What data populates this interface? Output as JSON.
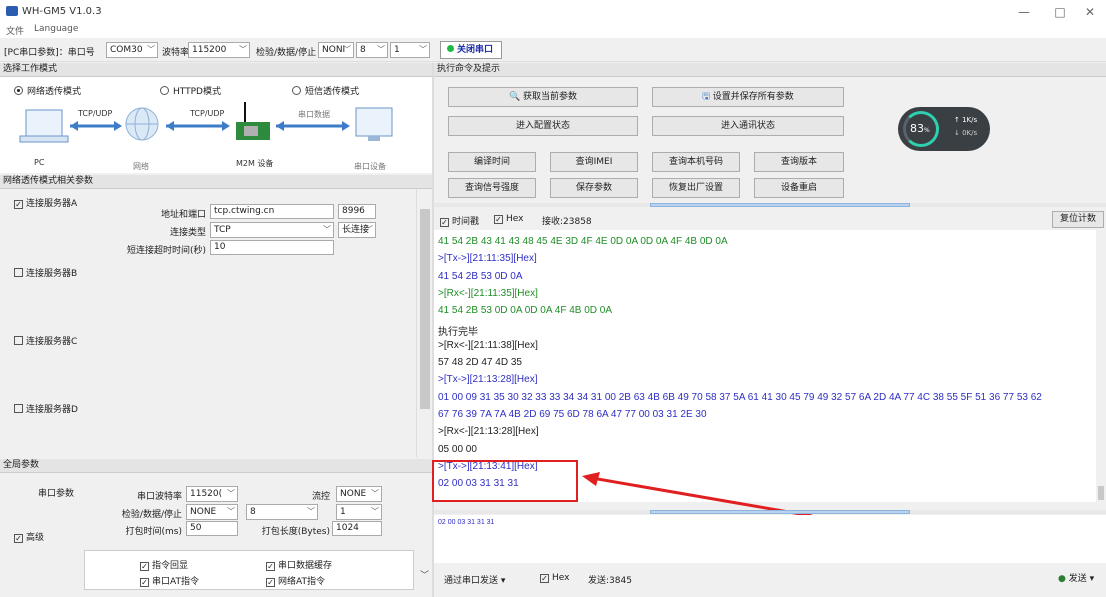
{
  "window": {
    "title": "WH-GM5 V1.0.3",
    "minimize": "—",
    "maximize": "□",
    "close": "✕"
  },
  "menu": [
    "文件",
    "Language"
  ],
  "toolbar": {
    "port_label": "[PC串口参数]：串口号",
    "port": "COM30",
    "baud_label": "波特率",
    "baud": "115200",
    "check_label": "检验/数据/停止",
    "parity": "NONI",
    "data_bits": "8",
    "stop_bits": "1",
    "open_button": "关闭串口"
  },
  "work_mode": {
    "header": "选择工作模式",
    "modes": [
      "网络透传模式",
      "HTTPD模式",
      "短信透传模式"
    ],
    "selected": 0
  },
  "diagram": {
    "tcp1": "TCP/UDP",
    "tcp2": "TCP/UDP",
    "serial_data": "串口数据",
    "pc": "PC",
    "network": "网络",
    "m2m": "M2M 设备",
    "serial_device": "串口设备"
  },
  "net_params": {
    "header": "网络透传模式相关参数",
    "server_a": "连接服务器A",
    "addr_label": "地址和端口",
    "addr": "tcp.ctwing.cn",
    "port": "8996",
    "conn_type_label": "连接类型",
    "conn_type": "TCP",
    "conn_mode": "长连接",
    "timeout_label": "短连接超时时间(秒)",
    "timeout": "10",
    "server_b": "连接服务器B",
    "server_c": "连接服务器C",
    "server_d": "连接服务器D"
  },
  "global": {
    "header": "全局参数",
    "serial_params": "串口参数",
    "baud_label": "串口波特率",
    "baud": "11520(",
    "flow_label": "流控",
    "flow": "NONE",
    "check_label": "检验/数据/停止",
    "parity": "NONE",
    "data_bits": "8",
    "stop_bits": "1",
    "pack_time_label": "打包时间(ms)",
    "pack_time": "50",
    "pack_len_label": "打包长度(Bytes)",
    "pack_len": "1024",
    "advanced": "高级",
    "opt1": "指令回显",
    "opt2": "串口数据缓存",
    "opt3": "串口AT指令",
    "opt4": "网络AT指令"
  },
  "commands": {
    "header": "执行命令及提示",
    "get_params": "获取当前参数",
    "save_all": "设置并保存所有参数",
    "enter_config": "进入配置状态",
    "enter_comm": "进入通讯状态",
    "compile_time": "编译时间",
    "query_imei": "查询IMEI",
    "query_number": "查询本机号码",
    "query_version": "查询版本",
    "query_signal": "查询信号强度",
    "save_params": "保存参数",
    "factory_reset": "恢复出厂设置",
    "reboot": "设备重启"
  },
  "gauge": {
    "percent": "83",
    "unit": "%",
    "up": "1K/s",
    "down": "0K/s"
  },
  "receive": {
    "time_label": "时间戳",
    "hex_label": "Hex",
    "count_label": "接收:23858",
    "reset": "复位计数"
  },
  "log": [
    {
      "t": "41 54 2B 43 41 43 48 45 4E 3D 4F 4E 0D 0A 0D 0A 4F 4B 0D 0A",
      "c": "green"
    },
    {
      "t": ">[Tx->][21:11:35][Hex]",
      "c": "blue"
    },
    {
      "t": "41 54 2B 53 0D 0A",
      "c": "blue"
    },
    {
      "t": ">[Rx<-][21:11:35][Hex]",
      "c": "green"
    },
    {
      "t": "41 54 2B 53 0D 0A 0D 0A 4F 4B 0D 0A",
      "c": "green"
    },
    {
      "t": "执行完毕",
      "c": "black"
    },
    {
      "t": ">[Rx<-][21:11:38][Hex]",
      "c": "black"
    },
    {
      "t": "57 48 2D 47 4D 35",
      "c": "black"
    },
    {
      "t": ">[Tx->][21:13:28][Hex]",
      "c": "blue"
    },
    {
      "t": "01 00 09 31 35 30 32 33 33 34 34 31 00 2B 63 4B 6B 49 70 58 37 5A 61 41 30 45 79 49 32 57 6A 2D 4A 77 4C 38 55 5F 51 36 77 53 62",
      "c": "blue"
    },
    {
      "t": "67 76 39 7A 7A 4B 2D 69 75 6D 78 6A 47 77 00 03 31 2E 30",
      "c": "blue"
    },
    {
      "t": ">[Rx<-][21:13:28][Hex]",
      "c": "black"
    },
    {
      "t": "05 00 00",
      "c": "black"
    },
    {
      "t": ">[Tx->][21:13:41][Hex]",
      "c": "blue"
    },
    {
      "t": "02 00 03 31 31 31",
      "c": "blue"
    }
  ],
  "send": {
    "text": "02 00 03 31 31 31",
    "via": "通过串口发送 ▾",
    "hex_label": "Hex",
    "count": "发送:3845",
    "send_button": "发送 ▾"
  },
  "colors": {
    "green": "#1f8d26",
    "blue": "#2e2ec4",
    "highlight": "#e02020"
  }
}
